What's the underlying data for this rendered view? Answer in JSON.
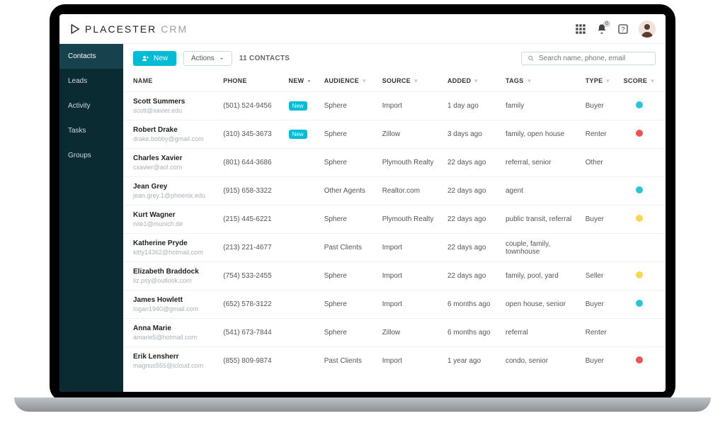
{
  "brand": {
    "name": "PLACESTER",
    "product": "CRM"
  },
  "topbar": {
    "notification_badge": "0"
  },
  "sidebar": {
    "items": [
      {
        "label": "Contacts",
        "active": true
      },
      {
        "label": "Leads"
      },
      {
        "label": "Activity"
      },
      {
        "label": "Tasks"
      },
      {
        "label": "Groups"
      }
    ]
  },
  "toolbar": {
    "new_label": "New",
    "actions_label": "Actions",
    "count_label": "11 CONTACTS",
    "search_placeholder": "Search name, phone, email"
  },
  "columns": {
    "name": "NAME",
    "phone": "PHONE",
    "new": "NEW",
    "audience": "AUDIENCE",
    "source": "SOURCE",
    "added": "ADDED",
    "tags": "TAGS",
    "type": "TYPE",
    "score": "SCORE"
  },
  "badge_new": "New",
  "contacts": [
    {
      "name": "Scott Summers",
      "email": "scott@xavier.edu",
      "phone": "(501) 524-9456",
      "is_new": true,
      "audience": "Sphere",
      "source": "Import",
      "added": "1 day ago",
      "tags": "family",
      "type": "Buyer",
      "score": "teal"
    },
    {
      "name": "Robert Drake",
      "email": "drake.bobby@gmail.com",
      "phone": "(310) 345-3673",
      "is_new": true,
      "audience": "Sphere",
      "source": "Zillow",
      "added": "3 days ago",
      "tags": "family, open house",
      "type": "Renter",
      "score": "red"
    },
    {
      "name": "Charles Xavier",
      "email": "cxavier@aol.com",
      "phone": "(801) 644-3686",
      "is_new": false,
      "audience": "Sphere",
      "source": "Plymouth Realty",
      "added": "22 days ago",
      "tags": "referral, senior",
      "type": "Other",
      "score": "none"
    },
    {
      "name": "Jean Grey",
      "email": "jean.grey.1@phoenix.edu",
      "phone": "(915) 658-3322",
      "is_new": false,
      "audience": "Other Agents",
      "source": "Realtor.com",
      "added": "22 days ago",
      "tags": "agent",
      "type": "",
      "score": "teal"
    },
    {
      "name": "Kurt Wagner",
      "email": "nite1@munich.de",
      "phone": "(215) 445-6221",
      "is_new": false,
      "audience": "Sphere",
      "source": "Plymouth Realty",
      "added": "22 days ago",
      "tags": "public transit, referral",
      "type": "Buyer",
      "score": "yellow"
    },
    {
      "name": "Katherine Pryde",
      "email": "kitty14362@hotmail.com",
      "phone": "(213) 221-4677",
      "is_new": false,
      "audience": "Past Clients",
      "source": "Import",
      "added": "22 days ago",
      "tags": "couple, family, townhouse",
      "type": "",
      "score": "none"
    },
    {
      "name": "Elizabeth Braddock",
      "email": "liz.psy@outlook.com",
      "phone": "(754) 533-2455",
      "is_new": false,
      "audience": "Sphere",
      "source": "Import",
      "added": "22 days ago",
      "tags": "family, pool, yard",
      "type": "Seller",
      "score": "yellow"
    },
    {
      "name": "James Howlett",
      "email": "logan1940@gmail.com",
      "phone": "(652) 578-3122",
      "is_new": false,
      "audience": "Sphere",
      "source": "Import",
      "added": "6 months ago",
      "tags": "open house, senior",
      "type": "Buyer",
      "score": "teal"
    },
    {
      "name": "Anna Marie",
      "email": "amarie5@hotmail.com",
      "phone": "(541) 673-7844",
      "is_new": false,
      "audience": "Sphere",
      "source": "Zillow",
      "added": "6 months ago",
      "tags": "referral",
      "type": "Renter",
      "score": "none"
    },
    {
      "name": "Erik Lensherr",
      "email": "magnus555@icloud.com",
      "phone": "(855) 809-9874",
      "is_new": false,
      "audience": "Past Clients",
      "source": "Import",
      "added": "1 year ago",
      "tags": "condo, senior",
      "type": "Buyer",
      "score": "red"
    }
  ]
}
